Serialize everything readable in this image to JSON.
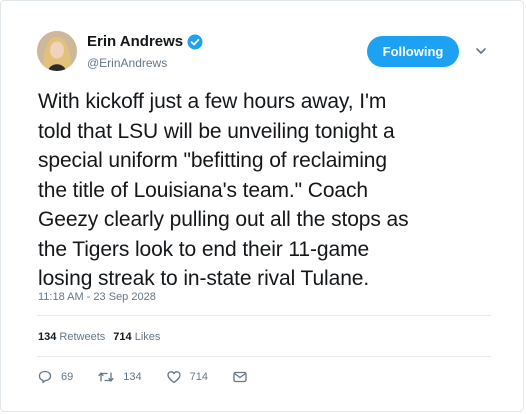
{
  "author": {
    "display_name": "Erin Andrews",
    "handle": "@ErinAndrews",
    "verified": true
  },
  "follow_button_label": "Following",
  "tweet": {
    "lines": [
      "With kickoff just a few hours away, I'm",
      "told that LSU will be unveiling tonight a",
      "special uniform \"befitting of reclaiming",
      "the title of Louisiana's team.\" Coach",
      "Geezy clearly pulling out all the stops as",
      "the Tigers look to end their 11-game",
      "losing streak to in-state rival Tulane."
    ],
    "timestamp": "11:18 AM - 23 Sep 2028"
  },
  "stats": {
    "retweets_count": "134",
    "retweets_label": "Retweets",
    "likes_count": "714",
    "likes_label": "Likes"
  },
  "actions": {
    "reply_count": "69",
    "retweet_count": "134",
    "like_count": "714"
  },
  "colors": {
    "accent": "#1da1f2",
    "muted": "#657786",
    "text": "#14171a"
  },
  "icons": [
    "verified-badge-icon",
    "chevron-down-icon",
    "reply-icon",
    "retweet-icon",
    "like-icon",
    "direct-message-icon"
  ]
}
